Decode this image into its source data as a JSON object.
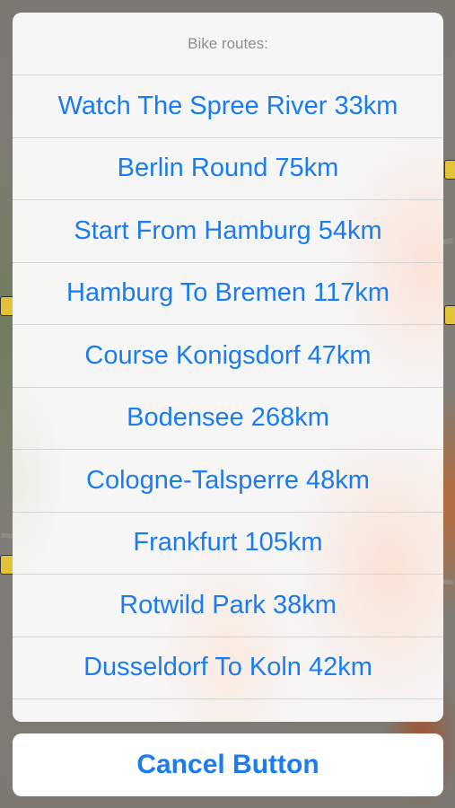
{
  "sheet": {
    "title": "Bike routes:",
    "routes": [
      "Watch The Spree River 33km",
      "Berlin Round 75km",
      "Start From Hamburg 54km",
      "Hamburg To Bremen 117km",
      "Course Konigsdorf 47km",
      "Bodensee 268km",
      "Cologne-Talsperre 48km",
      "Frankfurt 105km",
      "Rotwild Park 38km",
      "Dusseldorf To Koln 42km"
    ],
    "cancel_label": "Cancel Button"
  },
  "colors": {
    "accent": "#1a7cf0",
    "title_gray": "#8e8e93"
  }
}
